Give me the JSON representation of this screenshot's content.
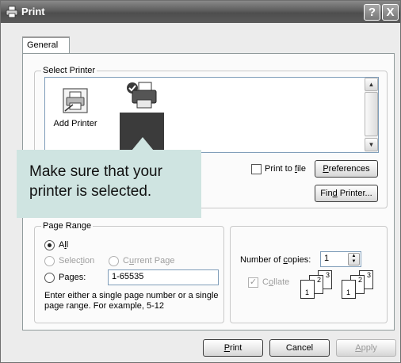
{
  "window": {
    "title": "Print",
    "help": "?",
    "close": "X"
  },
  "tabs": [
    {
      "label": "General"
    }
  ],
  "select_printer": {
    "legend": "Select Printer",
    "items": [
      {
        "label": "Add Printer",
        "icon": "add-printer-icon"
      },
      {
        "label": "",
        "icon": "printer-icon"
      }
    ],
    "print_to_file": {
      "pre": "Print to ",
      "accel": "f",
      "post": "ile",
      "checked": false
    },
    "preferences": {
      "pre": "",
      "accel": "P",
      "post": "references"
    },
    "find_printer": {
      "pre": "Fin",
      "accel": "d",
      "post": " Printer..."
    }
  },
  "callout": {
    "line1": "Make sure that your",
    "line2": "printer is selected."
  },
  "page_range": {
    "legend": "Page Range",
    "all": {
      "pre": "A",
      "accel": "l",
      "post": "l",
      "selected": true
    },
    "selection": {
      "pre": "Selec",
      "accel": "t",
      "post": "ion",
      "enabled": false
    },
    "current_page": {
      "pre": "C",
      "accel": "u",
      "post": "rrent Page",
      "enabled": false
    },
    "pages": {
      "label": "Pages:",
      "value": "1-65535"
    },
    "hint_line1": "Enter either a single page number or a single",
    "hint_line2": "page range.  For example, 5-12"
  },
  "copies": {
    "label_pre": "Number of ",
    "label_accel": "c",
    "label_post": "opies:",
    "value": "1",
    "collate": {
      "pre": "C",
      "accel": "o",
      "post": "llate",
      "checked": true,
      "enabled": false
    },
    "page_numbers": [
      "1",
      "2",
      "3"
    ]
  },
  "buttons": {
    "print": {
      "pre": "",
      "accel": "P",
      "post": "rint"
    },
    "cancel": "Cancel",
    "apply": {
      "pre": "",
      "accel": "A",
      "post": "pply"
    }
  }
}
